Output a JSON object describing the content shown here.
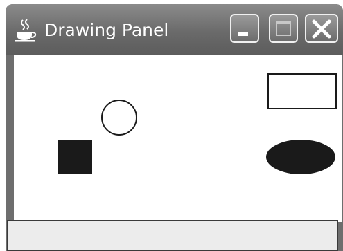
{
  "window": {
    "title": "Drawing Panel",
    "app_icon": "java-coffee-cup-icon",
    "buttons": [
      {
        "name": "minimize",
        "icon": "minimize-icon"
      },
      {
        "name": "maximize",
        "icon": "maximize-icon"
      },
      {
        "name": "close",
        "icon": "close-icon"
      }
    ]
  },
  "canvas": {
    "background": "#ffffff",
    "shapes": [
      {
        "type": "circle",
        "fill": "none",
        "stroke": "#1a1a1a"
      },
      {
        "type": "square",
        "fill": "#1a1a1a"
      },
      {
        "type": "rectangle",
        "fill": "none",
        "stroke": "#1a1a1a"
      },
      {
        "type": "oval",
        "fill": "#1a1a1a"
      }
    ]
  },
  "statusbar": {
    "text": ""
  }
}
